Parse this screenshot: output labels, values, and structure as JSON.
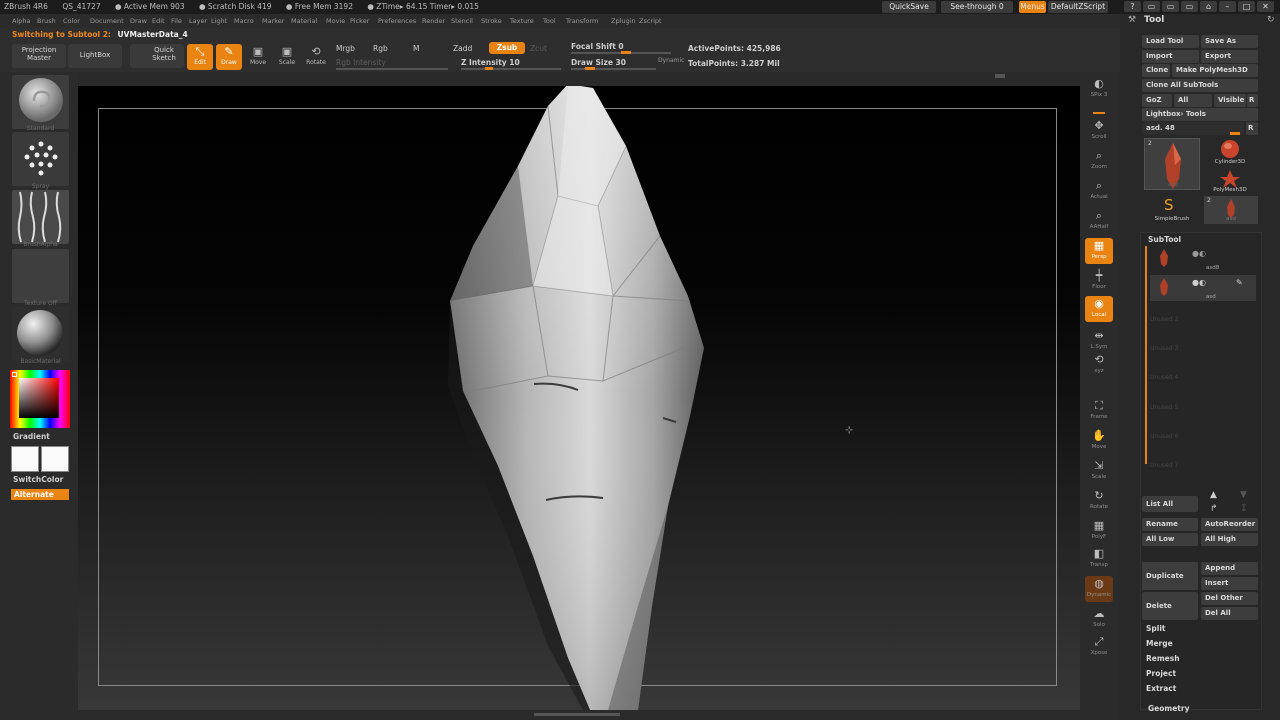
{
  "titlebar": {
    "app": "ZBrush 4R6",
    "build": "QS_41727",
    "active_mem": "● Active Mem 903",
    "scratch": "● Scratch Disk 419",
    "free_mem": "● Free Mem 3192",
    "ztime": "● ZTime▸ 64.15 Timer▸ 0.015",
    "quicksave": "QuickSave",
    "seethrough": "See-through  0",
    "menus": "Menus",
    "script": "DefaultZScript"
  },
  "menus": [
    "Alpha",
    "Brush",
    "Color",
    "Document",
    "Draw",
    "Edit",
    "File",
    "Layer",
    "Light",
    "Macro",
    "Marker",
    "Material",
    "Movie",
    "Picker",
    "Preferences",
    "Render",
    "Stencil",
    "Stroke",
    "Texture",
    "Tool",
    "Transform",
    "Zplugin",
    "Zscript"
  ],
  "status": {
    "prefix": "Switching to Subtool 2:",
    "name": "UVMasterData_4"
  },
  "toolbar": {
    "projection_master": "Projection Master",
    "lightbox": "LightBox",
    "quick_sketch": "Quick Sketch",
    "edit": "Edit",
    "draw": "Draw",
    "move": "Move",
    "scale": "Scale",
    "rotate": "Rotate",
    "mrgb": "Mrgb",
    "rgb": "Rgb",
    "m": "M",
    "zadd": "Zadd",
    "zsub": "Zsub",
    "zcut": "Zcut",
    "rgb_intensity": "Rgb Intensity",
    "z_intensity": "Z Intensity 10",
    "focal_shift": "Focal Shift 0",
    "draw_size": "Draw Size 30",
    "dynamic": "Dynamic",
    "active_points": "ActivePoints: 425,986",
    "total_points": "TotalPoints: 3.287 Mil"
  },
  "leftshelf": {
    "brush": "Standard",
    "stroke": "Spray",
    "alpha": "BrushAlpha",
    "texture": "Texture Off",
    "material": "BasicMaterial",
    "gradient": "Gradient",
    "switchcolor": "SwitchColor",
    "alternate": "Alternate"
  },
  "rightshelf": [
    {
      "name": "spix",
      "label": "SPix 3",
      "icon": "◐"
    },
    {
      "name": "scroll",
      "label": "Scroll",
      "icon": "✥"
    },
    {
      "name": "zoom",
      "label": "Zoom",
      "icon": "⌕"
    },
    {
      "name": "actual",
      "label": "Actual",
      "icon": "⌕"
    },
    {
      "name": "aahalf",
      "label": "AAHalf",
      "icon": "⌕"
    },
    {
      "name": "persp",
      "label": "Persp",
      "icon": "▦"
    },
    {
      "name": "floor",
      "label": "Floor",
      "icon": "┿"
    },
    {
      "name": "local",
      "label": "Local",
      "icon": "◉"
    },
    {
      "name": "lsym",
      "label": "L.Sym",
      "icon": "⇹"
    },
    {
      "name": "xyz",
      "label": "xyz",
      "icon": "⟲"
    },
    {
      "name": "frame",
      "label": "Frame",
      "icon": "⛶"
    },
    {
      "name": "move",
      "label": "Move",
      "icon": "✋"
    },
    {
      "name": "scale",
      "label": "Scale",
      "icon": "⇲"
    },
    {
      "name": "rotate",
      "label": "Rotate",
      "icon": "↻"
    },
    {
      "name": "polyf",
      "label": "PolyF",
      "icon": "▦"
    },
    {
      "name": "transp",
      "label": "Transp",
      "icon": "◧"
    },
    {
      "name": "ghost",
      "label": "Dynamic",
      "icon": "◍"
    },
    {
      "name": "solo",
      "label": "Solo",
      "icon": "☁"
    },
    {
      "name": "xpose",
      "label": "Xpose",
      "icon": "⤢"
    }
  ],
  "palette": {
    "title": "Tool",
    "load_tool": "Load Tool",
    "save_as": "Save As",
    "import": "Import",
    "export": "Export",
    "clone": "Clone",
    "make_polymesh": "Make PolyMesh3D",
    "clone_all": "Clone All SubTools",
    "goz": "GoZ",
    "all": "All",
    "visible": "Visible",
    "r": "R",
    "lightbox_tools": "Lightbox› Tools",
    "asd": "asd. 48",
    "tools": [
      {
        "name": "asd",
        "count": "2"
      },
      {
        "name": "Cylinder3D",
        "count": ""
      },
      {
        "name": "PolyMesh3D",
        "count": ""
      },
      {
        "name": "SimpleBrush",
        "count": ""
      },
      {
        "name": "asd",
        "count": "2"
      }
    ],
    "subtool_title": "SubTool",
    "subtools": [
      "asd8",
      "asd"
    ],
    "empty_slots": [
      "Unused 2",
      "Unused 3",
      "Unused 4",
      "Unused 5",
      "Unused 6",
      "Unused 7"
    ],
    "list_all": "List All",
    "rename": "Rename",
    "autoreorder": "AutoReorder",
    "all_low": "All Low",
    "all_high": "All High",
    "append": "Append",
    "duplicate": "Duplicate",
    "insert": "Insert",
    "delete": "Delete",
    "del_other": "Del Other",
    "del_all": "Del All",
    "split": "Split",
    "merge": "Merge",
    "remesh": "Remesh",
    "project": "Project",
    "extract": "Extract",
    "geometry": "Geometry"
  },
  "colors": {
    "accent": "#e98312",
    "panel": "#2b2b2b",
    "button": "#3d3d3d"
  }
}
